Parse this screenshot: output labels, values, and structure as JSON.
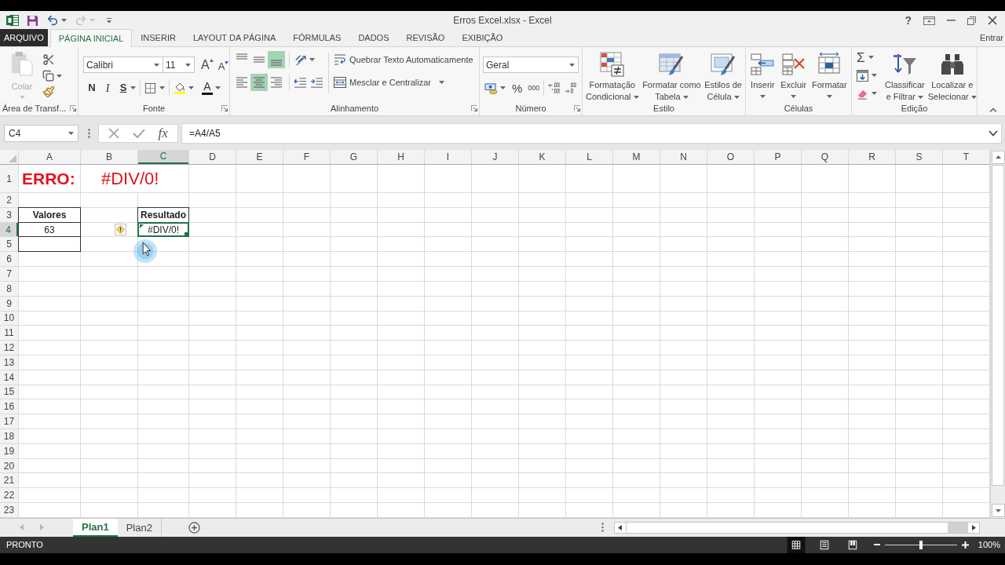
{
  "title_bar": {
    "title": "Erros Excel.xlsx - Excel",
    "help": "?"
  },
  "ribbon_tabs": [
    {
      "label": "ARQUIVO",
      "kind": "file",
      "selected": false
    },
    {
      "label": "PÁGINA INICIAL",
      "kind": "tab",
      "selected": true
    },
    {
      "label": "INSERIR",
      "kind": "tab",
      "selected": false
    },
    {
      "label": "LAYOUT DA PÁGINA",
      "kind": "tab",
      "selected": false
    },
    {
      "label": "FÓRMULAS",
      "kind": "tab",
      "selected": false
    },
    {
      "label": "DADOS",
      "kind": "tab",
      "selected": false
    },
    {
      "label": "REVISÃO",
      "kind": "tab",
      "selected": false
    },
    {
      "label": "EXIBIÇÃO",
      "kind": "tab",
      "selected": false
    }
  ],
  "account": {
    "label": "Entrar"
  },
  "ribbon": {
    "clipboard": {
      "label": "Área de Transf...",
      "launcher": true,
      "paste": {
        "label": "Colar",
        "disabled": true
      }
    },
    "font": {
      "label": "Fonte",
      "launcher": true,
      "font_name": "Calibri",
      "font_size": "11",
      "grow": "A",
      "shrink": "A",
      "bold": "N",
      "italic": "I",
      "underline": "S",
      "font_color": "A"
    },
    "alignment": {
      "label": "Alinhamento",
      "launcher": true,
      "vertical": [
        {
          "selected": false
        },
        {
          "selected": false
        },
        {
          "selected": true
        }
      ],
      "horizontal": [
        {
          "selected": false
        },
        {
          "selected": true
        },
        {
          "selected": false
        }
      ],
      "wrap_text": "Quebrar Texto Automaticamente",
      "merge": "Mesclar e Centralizar"
    },
    "number": {
      "label": "Número",
      "launcher": true,
      "format": "Geral",
      "percent": "%",
      "thousands": "000"
    },
    "styles": {
      "label": "Estilo",
      "launcher": false,
      "buttons": [
        {
          "lines": [
            "Formatação",
            "Condicional"
          ]
        },
        {
          "lines": [
            "Formatar como",
            "Tabela"
          ]
        },
        {
          "lines": [
            "Estilos de",
            "Célula"
          ]
        }
      ]
    },
    "cells": {
      "label": "Células",
      "launcher": false,
      "buttons": [
        "Inserir",
        "Excluir",
        "Formatar"
      ]
    },
    "editing": {
      "label": "Edição",
      "launcher": false,
      "autosum": "Σ",
      "buttons": [
        {
          "lines": [
            "Classificar",
            "e Filtrar"
          ]
        },
        {
          "lines": [
            "Localizar e",
            "Selecionar"
          ]
        }
      ]
    }
  },
  "formula_bar": {
    "name_box": "C4",
    "function_label": "fx",
    "formula": "=A4/A5"
  },
  "sheet": {
    "columns": [
      {
        "label": "A",
        "selected": false
      },
      {
        "label": "B",
        "selected": false
      },
      {
        "label": "C",
        "selected": true
      },
      {
        "label": "D",
        "selected": false
      },
      {
        "label": "E",
        "selected": false
      },
      {
        "label": "F",
        "selected": false
      },
      {
        "label": "G",
        "selected": false
      },
      {
        "label": "H",
        "selected": false
      },
      {
        "label": "I",
        "selected": false
      },
      {
        "label": "J",
        "selected": false
      },
      {
        "label": "K",
        "selected": false
      },
      {
        "label": "L",
        "selected": false
      },
      {
        "label": "M",
        "selected": false
      },
      {
        "label": "N",
        "selected": false
      },
      {
        "label": "O",
        "selected": false
      },
      {
        "label": "P",
        "selected": false
      },
      {
        "label": "Q",
        "selected": false
      },
      {
        "label": "R",
        "selected": false
      },
      {
        "label": "S",
        "selected": false
      },
      {
        "label": "T",
        "selected": false
      }
    ],
    "rows": [
      {
        "label": "1",
        "selected": false,
        "cells": {
          "A": {
            "kind": "heading",
            "text": "ERRO:",
            "selected": false
          },
          "B": {
            "kind": "error_heading",
            "text": "#DIV/0!",
            "selected": false
          }
        }
      },
      {
        "label": "2",
        "selected": false
      },
      {
        "label": "3",
        "selected": false,
        "cells": {
          "A": {
            "kind": "header",
            "text": "Valores",
            "selected": false
          },
          "C": {
            "kind": "header",
            "text": "Resultado",
            "selected": false
          }
        }
      },
      {
        "label": "4",
        "selected": true,
        "cells": {
          "A": {
            "kind": "value",
            "text": "63",
            "selected": false
          },
          "B": {
            "kind": "warning",
            "selected": false
          },
          "C": {
            "kind": "error",
            "text": "#DIV/0!",
            "selected": true
          }
        }
      },
      {
        "label": "5",
        "selected": false,
        "cells": {
          "A": {
            "kind": "value",
            "selected": false
          }
        }
      },
      {
        "label": "6",
        "selected": false
      },
      {
        "label": "7",
        "selected": false
      },
      {
        "label": "8",
        "selected": false
      },
      {
        "label": "9",
        "selected": false
      },
      {
        "label": "10",
        "selected": false
      },
      {
        "label": "11",
        "selected": false
      },
      {
        "label": "12",
        "selected": false
      },
      {
        "label": "13",
        "selected": false
      },
      {
        "label": "14",
        "selected": false
      },
      {
        "label": "15",
        "selected": false
      },
      {
        "label": "16",
        "selected": false
      },
      {
        "label": "17",
        "selected": false
      },
      {
        "label": "18",
        "selected": false
      },
      {
        "label": "19",
        "selected": false
      },
      {
        "label": "20",
        "selected": false
      },
      {
        "label": "21",
        "selected": false
      },
      {
        "label": "22",
        "selected": false
      },
      {
        "label": "23",
        "selected": false
      }
    ]
  },
  "sheet_tabs": [
    {
      "label": "Plan1",
      "selected": true
    },
    {
      "label": "Plan2",
      "selected": false
    }
  ],
  "status_bar": {
    "status": "PRONTO",
    "views": [
      {
        "selected": true
      },
      {
        "selected": false
      },
      {
        "selected": false
      }
    ],
    "zoom": {
      "level": 0.5,
      "reading": "100%"
    }
  }
}
